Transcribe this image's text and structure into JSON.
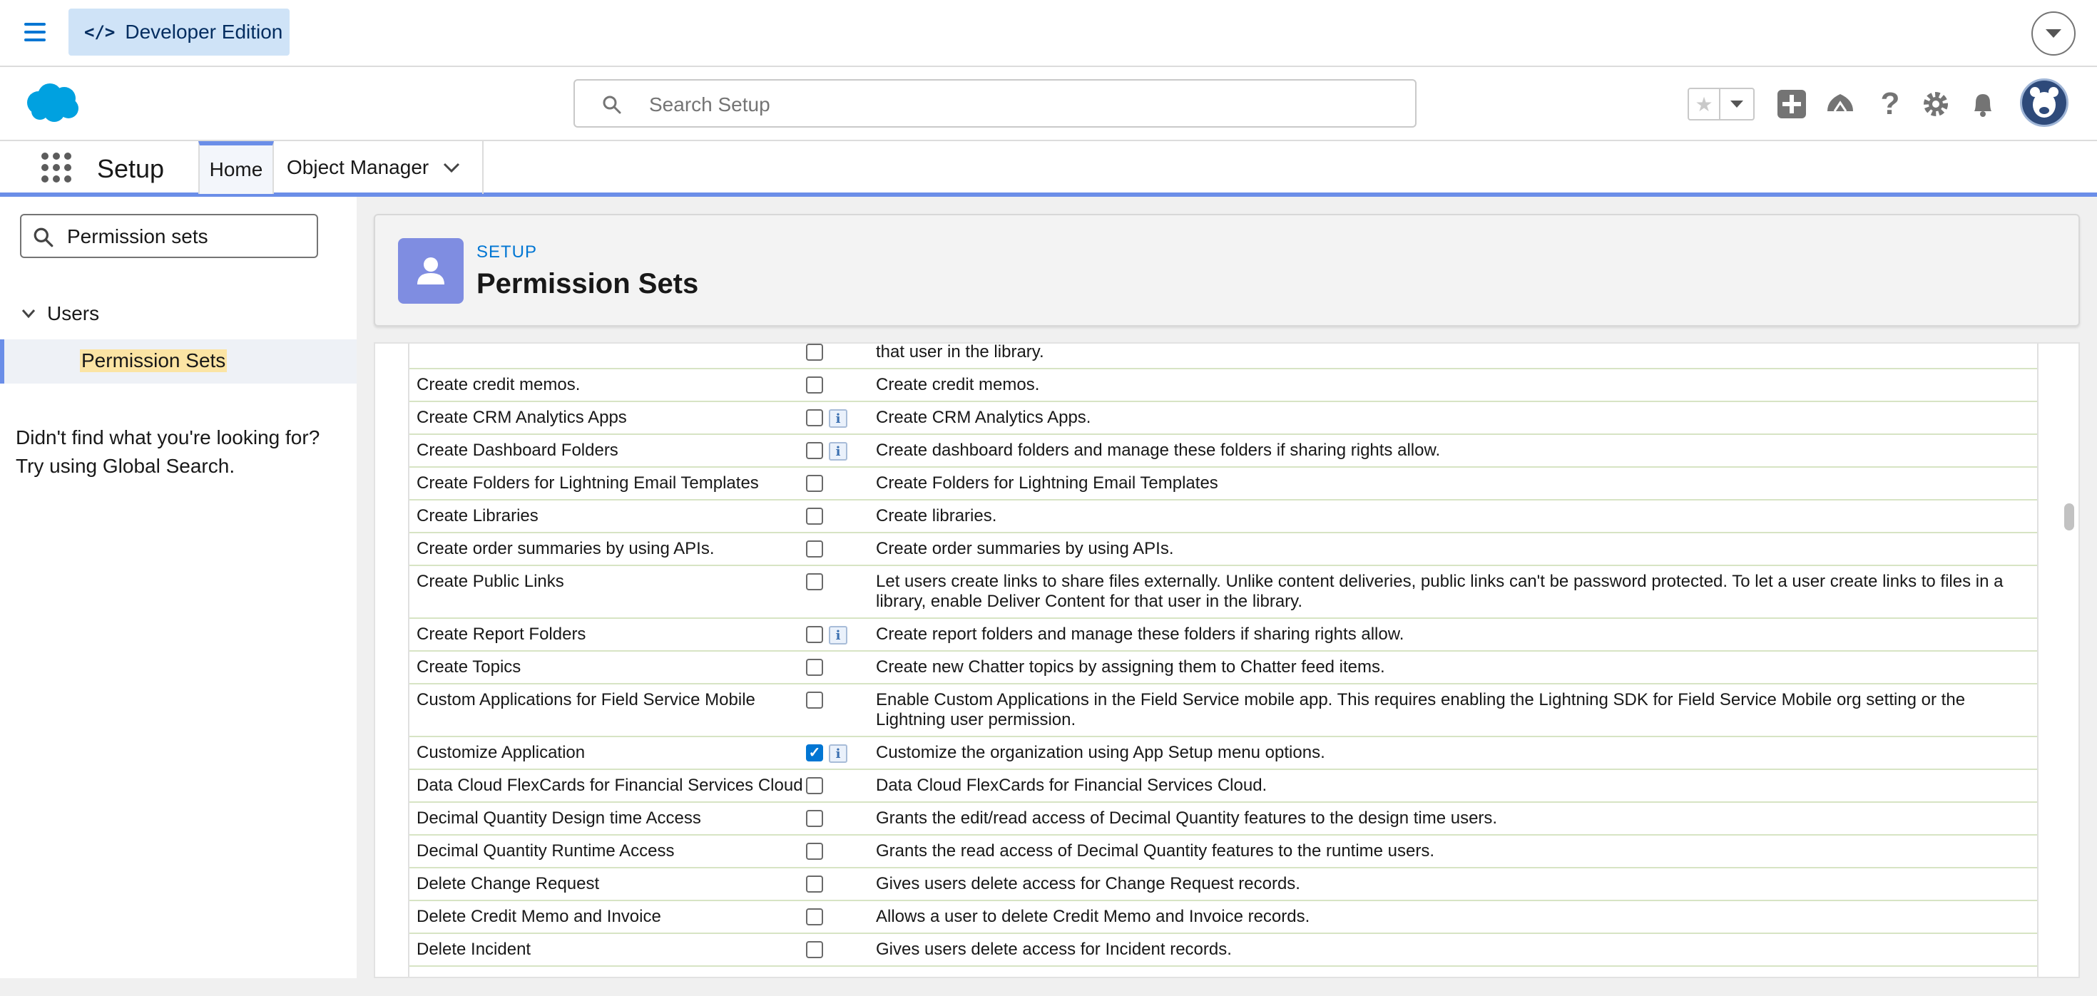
{
  "devbar": {
    "edition_label": "Developer Edition"
  },
  "header": {
    "search_placeholder": "Search Setup"
  },
  "context": {
    "app_name": "Setup",
    "tab_home": "Home",
    "tab_object_manager": "Object Manager"
  },
  "left": {
    "quickfind_value": "Permission sets",
    "tree_parent": "Users",
    "tree_child": "Permission Sets",
    "not_found_line1": "Didn't find what you're looking for?",
    "not_found_line2": "Try using Global Search."
  },
  "page": {
    "breadcrumb": "SETUP",
    "title": "Permission Sets"
  },
  "colors": {
    "brand": "#0176d3",
    "accent": "#6b8ee8",
    "page_icon": "#7f8de1",
    "highlight": "#fbe4a4"
  },
  "rows": [
    {
      "name": "",
      "checked": false,
      "info": false,
      "desc": "that user in the library."
    },
    {
      "name": "Create credit memos.",
      "checked": false,
      "info": false,
      "desc": "Create credit memos."
    },
    {
      "name": "Create CRM Analytics Apps",
      "checked": false,
      "info": true,
      "desc": "Create CRM Analytics Apps."
    },
    {
      "name": "Create Dashboard Folders",
      "checked": false,
      "info": true,
      "desc": "Create dashboard folders and manage these folders if sharing rights allow."
    },
    {
      "name": "Create Folders for Lightning Email Templates",
      "checked": false,
      "info": false,
      "desc": "Create Folders for Lightning Email Templates"
    },
    {
      "name": "Create Libraries",
      "checked": false,
      "info": false,
      "desc": "Create libraries."
    },
    {
      "name": "Create order summaries by using APIs.",
      "checked": false,
      "info": false,
      "desc": "Create order summaries by using APIs."
    },
    {
      "name": "Create Public Links",
      "checked": false,
      "info": false,
      "desc": "Let users create links to share files externally. Unlike content deliveries, public links can't be password protected. To let a user create links to files in a library, enable Deliver Content for that user in the library."
    },
    {
      "name": "Create Report Folders",
      "checked": false,
      "info": true,
      "desc": "Create report folders and manage these folders if sharing rights allow."
    },
    {
      "name": "Create Topics",
      "checked": false,
      "info": false,
      "desc": "Create new Chatter topics by assigning them to Chatter feed items."
    },
    {
      "name": "Custom Applications for Field Service Mobile",
      "checked": false,
      "info": false,
      "desc": "Enable Custom Applications in the Field Service mobile app. This requires enabling the Lightning SDK for Field Service Mobile org setting or the Lightning user permission."
    },
    {
      "name": "Customize Application",
      "checked": true,
      "info": true,
      "desc": "Customize the organization using App Setup menu options."
    },
    {
      "name": "Data Cloud FlexCards for Financial Services Cloud",
      "checked": false,
      "info": false,
      "desc": "Data Cloud FlexCards for Financial Services Cloud."
    },
    {
      "name": "Decimal Quantity Design time Access",
      "checked": false,
      "info": false,
      "desc": "Grants the edit/read access of Decimal Quantity features to the design time users."
    },
    {
      "name": "Decimal Quantity Runtime Access",
      "checked": false,
      "info": false,
      "desc": "Grants the read access of Decimal Quantity features to the runtime users."
    },
    {
      "name": "Delete Change Request",
      "checked": false,
      "info": false,
      "desc": "Gives users delete access for Change Request records."
    },
    {
      "name": "Delete Credit Memo and Invoice",
      "checked": false,
      "info": false,
      "desc": "Allows a user to delete Credit Memo and Invoice records."
    },
    {
      "name": "Delete Incident",
      "checked": false,
      "info": false,
      "desc": "Gives users delete access for Incident records."
    },
    {
      "name": "",
      "checked": false,
      "info": false,
      "desc": ""
    }
  ]
}
